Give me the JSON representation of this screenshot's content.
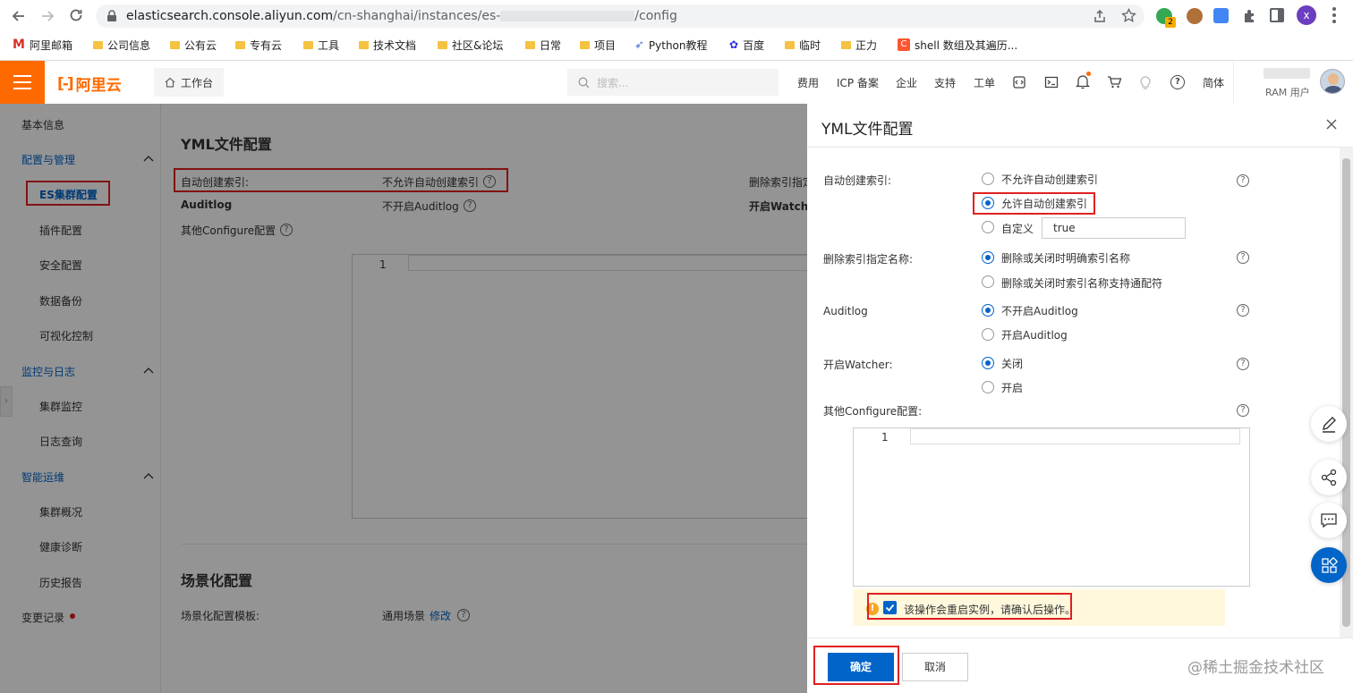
{
  "browser": {
    "url_host": "elasticsearch.console.aliyun.com",
    "url_path_start": "/cn-shanghai/instances/es-",
    "url_path_end": "/config",
    "profile_initial": "x",
    "ext_badge": "2",
    "bookmarks": [
      "阿里邮箱",
      "公司信息",
      "公有云",
      "专有云",
      "工具",
      "技术文档",
      "社区&论坛",
      "日常",
      "项目",
      "Python教程",
      "百度",
      "临时",
      "正力",
      "shell 数组及其遍历..."
    ]
  },
  "header": {
    "logo_text": "阿里云",
    "workbench": "工作台",
    "search_placeholder": "搜索...",
    "nav": [
      "费用",
      "ICP 备案",
      "企业",
      "支持",
      "工单"
    ],
    "lang": "简体",
    "user_role": "RAM 用户"
  },
  "sidebar": {
    "basic_info": "基本信息",
    "group1": "配置与管理",
    "items1": [
      "ES集群配置",
      "插件配置",
      "安全配置",
      "数据备份",
      "可视化控制"
    ],
    "group2": "监控与日志",
    "items2": [
      "集群监控",
      "日志查询"
    ],
    "group3": "智能运维",
    "items3": [
      "集群概况",
      "健康诊断",
      "历史报告"
    ],
    "changelog": "变更记录"
  },
  "main": {
    "section_title": "YML文件配置",
    "auto_index_label": "自动创建索引:",
    "auto_index_value": "不允许自动创建索引",
    "delete_label": "删除索引指定",
    "auditlog_label": "Auditlog",
    "auditlog_value": "不开启Auditlog",
    "watcher_label": "开启Watche",
    "other_label": "其他Configure配置",
    "line_number": "1",
    "scene_title": "场景化配置",
    "scene_label": "场景化配置模板:",
    "scene_value": "通用场景",
    "scene_edit": "修改"
  },
  "drawer": {
    "title": "YML文件配置",
    "auto_index": {
      "label": "自动创建索引:",
      "options": [
        "不允许自动创建索引",
        "允许自动创建索引",
        "自定义"
      ],
      "selected": 1,
      "custom_value": "true"
    },
    "delete_index": {
      "label": "删除索引指定名称:",
      "options": [
        "删除或关闭时明确索引名称",
        "删除或关闭时索引名称支持通配符"
      ],
      "selected": 0
    },
    "auditlog": {
      "label": "Auditlog",
      "options": [
        "不开启Auditlog",
        "开启Auditlog"
      ],
      "selected": 0
    },
    "watcher": {
      "label": "开启Watcher:",
      "options": [
        "关闭",
        "开启"
      ],
      "selected": 0
    },
    "other_config": {
      "label": "其他Configure配置:",
      "line_number": "1"
    },
    "confirm_text": "该操作会重启实例，请确认后操作。",
    "confirm_checked": true,
    "ok_button": "确定",
    "cancel_button": "取消"
  },
  "watermark": "@稀土掘金技术社区",
  "colors": {
    "brand": "#ff6a00",
    "primary": "#0064c8",
    "highlight": "#e02020",
    "warn_bg": "#fff8dc"
  }
}
